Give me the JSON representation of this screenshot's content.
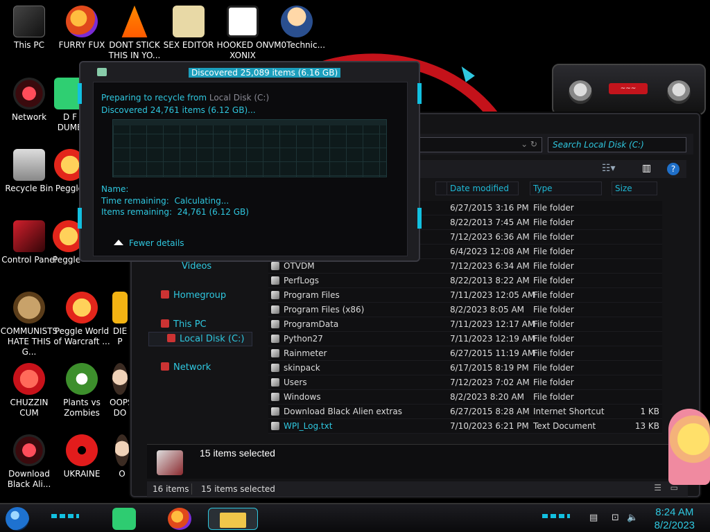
{
  "desktop": {
    "icons": [
      {
        "label": "This PC"
      },
      {
        "label": "FURRY FUX"
      },
      {
        "label": "DONT STICK THIS IN YO..."
      },
      {
        "label": "SEX EDITOR"
      },
      {
        "label": "HOOKED ON XONIX"
      },
      {
        "label": "VM0Technic..."
      },
      {
        "label": "Network"
      },
      {
        "label": "D F DUMB"
      },
      {
        "label": "Recycle Bin"
      },
      {
        "label": "Peggle"
      },
      {
        "label": "Control Panel"
      },
      {
        "label": "Peggle Nights Deluxe"
      },
      {
        "label": "COMMUNISTS HATE THIS G..."
      },
      {
        "label": "Peggle World of Warcraft ..."
      },
      {
        "label": "DIE P"
      },
      {
        "label": "CHUZZIN CUM"
      },
      {
        "label": "Plants vs Zombies"
      },
      {
        "label": "OOPS DO"
      },
      {
        "label": "Download Black Ali..."
      },
      {
        "label": "UKRAINE"
      },
      {
        "label": "O"
      }
    ]
  },
  "dialog": {
    "title": "Discovered 25,089 items (6.16 GB)",
    "preparing_prefix": "Preparing to recycle from",
    "preparing_source": "Local Disk (C:)",
    "discovered": "Discovered 24,761 items (6.12 GB)...",
    "name_label": "Name:",
    "time_label": "Time remaining:",
    "time_value": "Calculating...",
    "items_label": "Items remaining:",
    "items_value": "24,761 (6.12 GB)",
    "fewer_details": "Fewer details"
  },
  "explorer": {
    "search_placeholder": "Search Local Disk (C:)",
    "columns": {
      "date": "Date modified",
      "type": "Type",
      "size": "Size"
    },
    "nav": {
      "videos": "Videos",
      "homegroup": "Homegroup",
      "this_pc": "This PC",
      "local_disk": "Local Disk (C:)",
      "network": "Network"
    },
    "rows": [
      {
        "name": "",
        "date": "6/27/2015 3:16 PM",
        "type": "File folder",
        "size": ""
      },
      {
        "name": "",
        "date": "8/22/2013 7:45 AM",
        "type": "File folder",
        "size": ""
      },
      {
        "name": "",
        "date": "7/12/2023 6:36 AM",
        "type": "File folder",
        "size": ""
      },
      {
        "name": "",
        "date": "6/4/2023 12:08 AM",
        "type": "File folder",
        "size": ""
      },
      {
        "name": "OTVDM",
        "date": "7/12/2023 6:34 AM",
        "type": "File folder",
        "size": ""
      },
      {
        "name": "PerfLogs",
        "date": "8/22/2013 8:22 AM",
        "type": "File folder",
        "size": ""
      },
      {
        "name": "Program Files",
        "date": "7/11/2023 12:05 AM",
        "type": "File folder",
        "size": ""
      },
      {
        "name": "Program Files (x86)",
        "date": "8/2/2023 8:05 AM",
        "type": "File folder",
        "size": ""
      },
      {
        "name": "ProgramData",
        "date": "7/11/2023 12:17 AM",
        "type": "File folder",
        "size": ""
      },
      {
        "name": "Python27",
        "date": "7/11/2023 12:19 AM",
        "type": "File folder",
        "size": ""
      },
      {
        "name": "Rainmeter",
        "date": "6/27/2015 11:19 AM",
        "type": "File folder",
        "size": ""
      },
      {
        "name": "skinpack",
        "date": "6/17/2015 8:19 PM",
        "type": "File folder",
        "size": ""
      },
      {
        "name": "Users",
        "date": "7/12/2023 7:02 AM",
        "type": "File folder",
        "size": ""
      },
      {
        "name": "Windows",
        "date": "8/2/2023 8:20 AM",
        "type": "File folder",
        "size": ""
      },
      {
        "name": "Download Black Alien extras",
        "date": "6/27/2015 8:28 AM",
        "type": "Internet Shortcut",
        "size": "1 KB"
      },
      {
        "name": "WPI_Log.txt",
        "date": "7/10/2023 6:21 PM",
        "type": "Text Document",
        "size": "13 KB"
      }
    ],
    "details_text": "15 items selected",
    "status_count": "16 items",
    "status_selected": "15 items selected"
  },
  "taskbar": {
    "time": "8:24 AM",
    "date": "8/2/2023"
  },
  "colors": {
    "accent": "#2fc8e0",
    "alien_red": "#c4121a"
  }
}
